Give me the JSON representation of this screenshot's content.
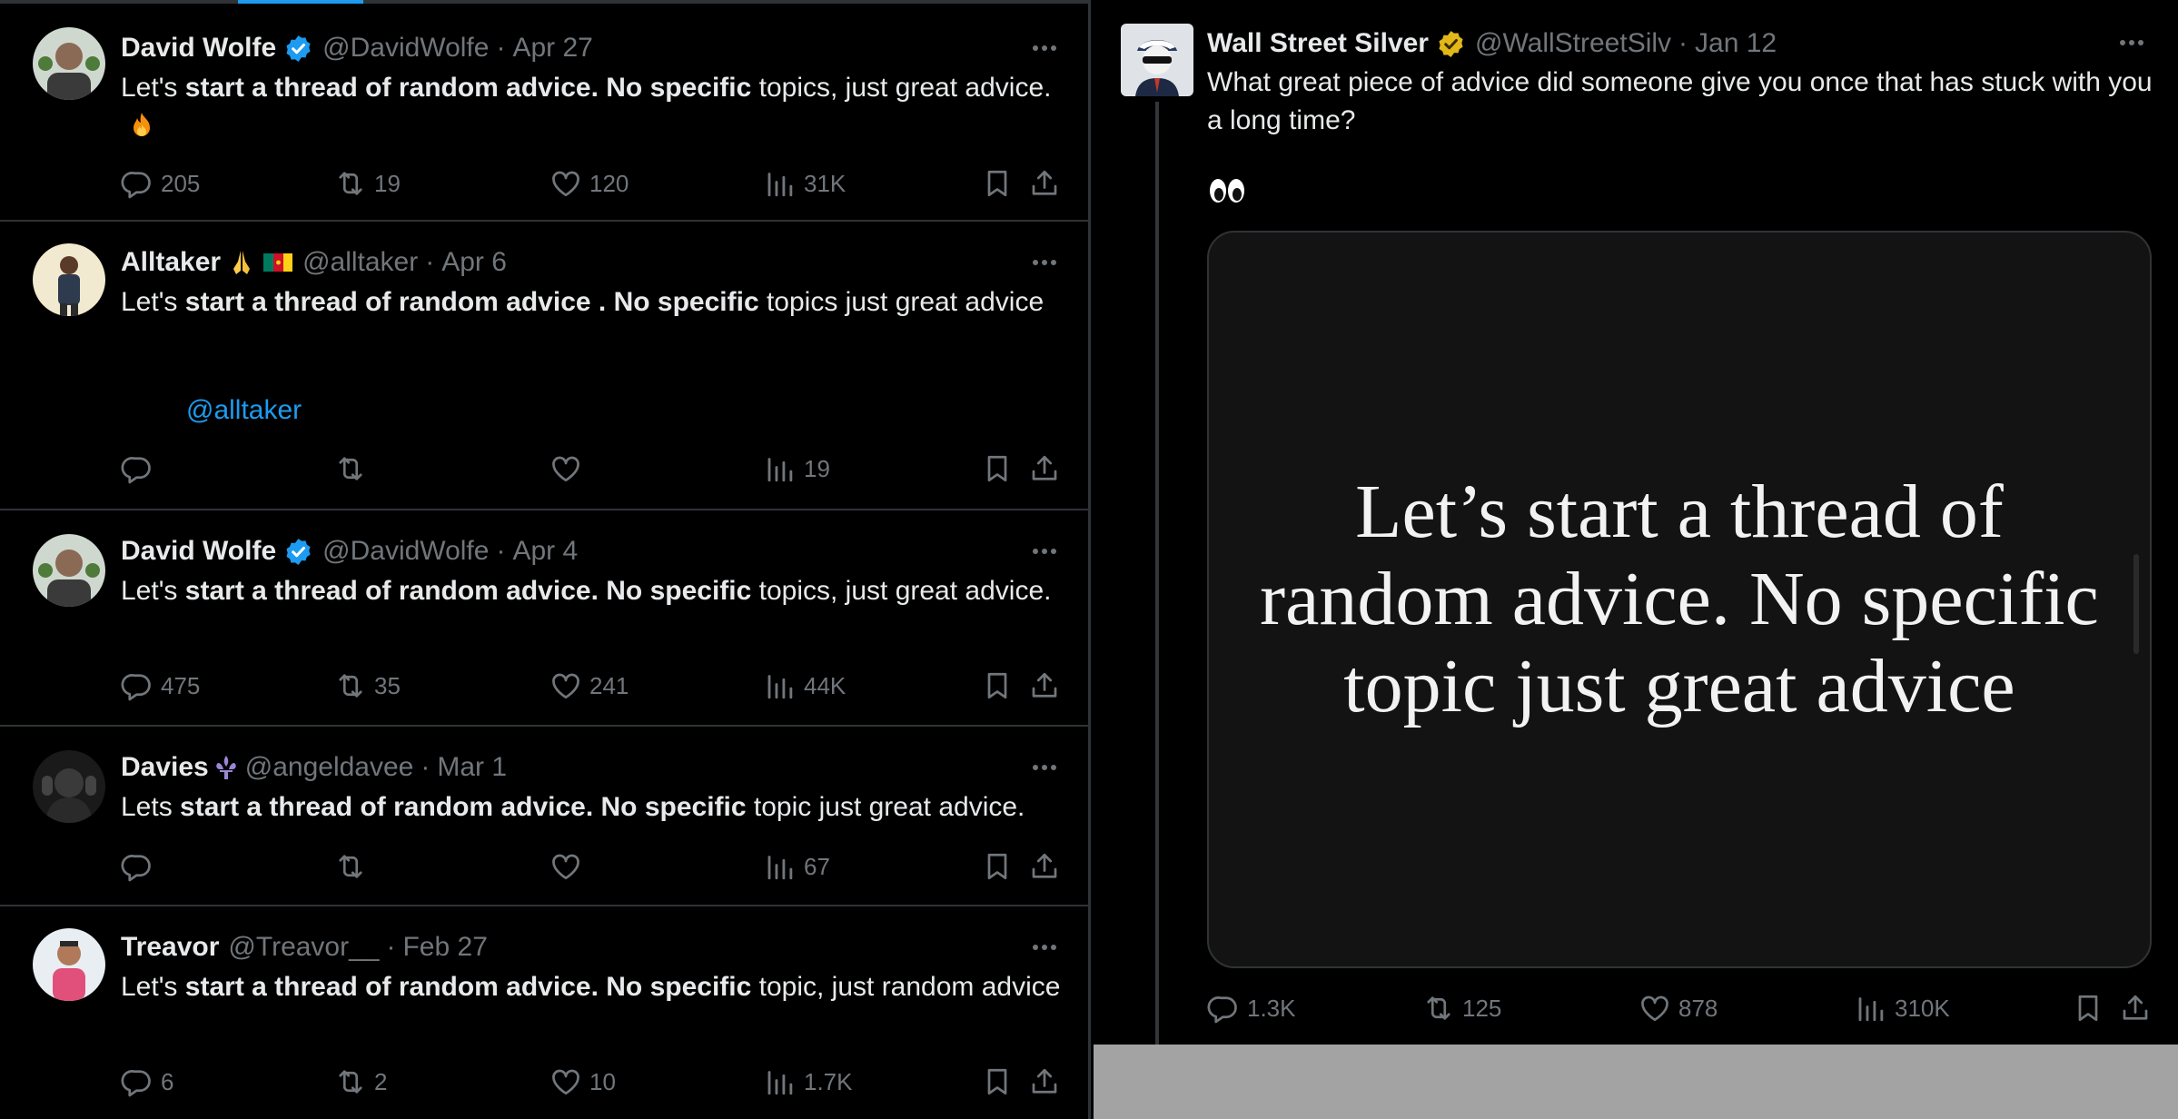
{
  "left_feed": {
    "tweets": [
      {
        "name": "David Wolfe",
        "verified": "blue",
        "handle": "@DavidWolfe",
        "date": "Apr 27",
        "text_parts": [
          "Let's ",
          "start a thread of random advice. No specific",
          " topics, just great advice."
        ],
        "emoji": "fire-emoji",
        "replies": "205",
        "reposts": "19",
        "likes": "120",
        "views": "31K"
      },
      {
        "name": "Alltaker",
        "name_emoji": "pray-emoji cameroon-flag",
        "handle": "@alltaker",
        "date": "Apr 6",
        "text_parts": [
          "Let's ",
          "start a thread of random advice . No specific",
          " topics just great advice"
        ],
        "mention": "@alltaker",
        "replies": "",
        "reposts": "",
        "likes": "",
        "views": "19"
      },
      {
        "name": "David Wolfe",
        "verified": "blue",
        "handle": "@DavidWolfe",
        "date": "Apr 4",
        "text_parts": [
          "Let's ",
          "start a thread of random advice. No specific",
          " topics, just great advice."
        ],
        "replies": "475",
        "reposts": "35",
        "likes": "241",
        "views": "44K"
      },
      {
        "name": "Davies",
        "name_emoji": "fleur-de-lis-emoji",
        "handle": "@angeldavee",
        "date": "Mar 1",
        "text_parts": [
          "Lets ",
          "start a thread of random advice. No specific",
          " topic just great advice."
        ],
        "replies": "",
        "reposts": "",
        "likes": "",
        "views": "67"
      },
      {
        "name": "Treavor",
        "handle": "@Treavor__",
        "date": "Feb 27",
        "text_parts": [
          "Let's ",
          "start a thread of random advice. No specific",
          " topic, just random advice"
        ],
        "replies": "6",
        "reposts": "2",
        "likes": "10",
        "views": "1.7K"
      }
    ]
  },
  "right_tweet": {
    "name": "Wall Street Silver",
    "verified": "gold",
    "handle": "@WallStreetSilv",
    "date": "Jan 12",
    "text": "What great piece of advice did someone give you once that has stuck with you a long time?",
    "emoji": "eyes-emoji",
    "image_text": "Let’s start a thread of random advice. No specific topic just great advice",
    "replies": "1.3K",
    "reposts": "125",
    "likes": "878",
    "views": "310K"
  },
  "separator": "·",
  "colors": {
    "background": "#000000",
    "text": "#e7e9ea",
    "muted": "#71767b",
    "border": "#2f3336",
    "link": "#1d9bf0",
    "verified_blue": "#1d9bf0",
    "verified_gold": "#e2b719"
  },
  "icons": [
    "reply-icon",
    "repost-icon",
    "like-icon",
    "views-icon",
    "bookmark-icon",
    "share-icon",
    "more-icon"
  ]
}
